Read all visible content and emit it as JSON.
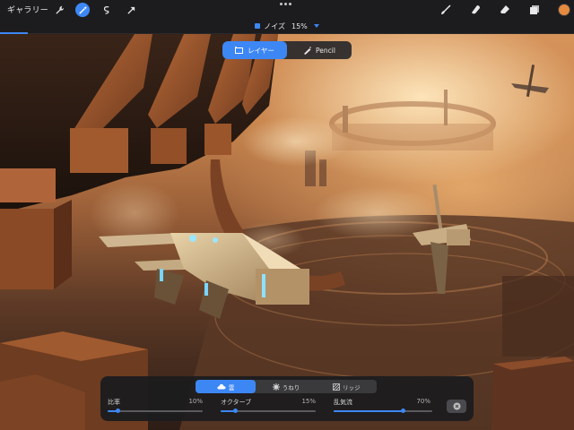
{
  "toolbar": {
    "gallery_label": "ギャラリー",
    "left_tools": [
      {
        "icon": "wrench-icon",
        "name": "actions"
      },
      {
        "icon": "magic-wand-icon",
        "name": "adjustments",
        "active": true
      },
      {
        "icon": "selection-icon",
        "name": "selection"
      },
      {
        "icon": "transform-arrow-icon",
        "name": "transform"
      }
    ],
    "right_tools": [
      {
        "icon": "brush-icon",
        "name": "paint"
      },
      {
        "icon": "smudge-icon",
        "name": "smudge"
      },
      {
        "icon": "eraser-icon",
        "name": "erase"
      },
      {
        "icon": "layers-icon",
        "name": "layers"
      }
    ],
    "color": "#e58a3f"
  },
  "adjustment": {
    "name": "ノイズ",
    "percent": "15%",
    "mode_options": [
      "レイヤー",
      "Pencil"
    ],
    "active_mode": "レイヤー"
  },
  "panel": {
    "tabs": [
      {
        "label": "雲",
        "icon": "cloud-icon",
        "active": true
      },
      {
        "label": "うねり",
        "icon": "swirl-icon",
        "active": false
      },
      {
        "label": "リッジ",
        "icon": "ridge-icon",
        "active": false
      }
    ],
    "sliders": [
      {
        "label": "比率",
        "value_text": "10%",
        "value": 0.1
      },
      {
        "label": "オクターブ",
        "value_text": "15%",
        "value": 0.15
      },
      {
        "label": "乱気流",
        "value_text": "70%",
        "value": 0.7
      }
    ]
  },
  "colors": {
    "accent": "#3d87f5",
    "toolbar_bg": "#1c1c1e",
    "panel_bg": "#1c1c1e"
  }
}
